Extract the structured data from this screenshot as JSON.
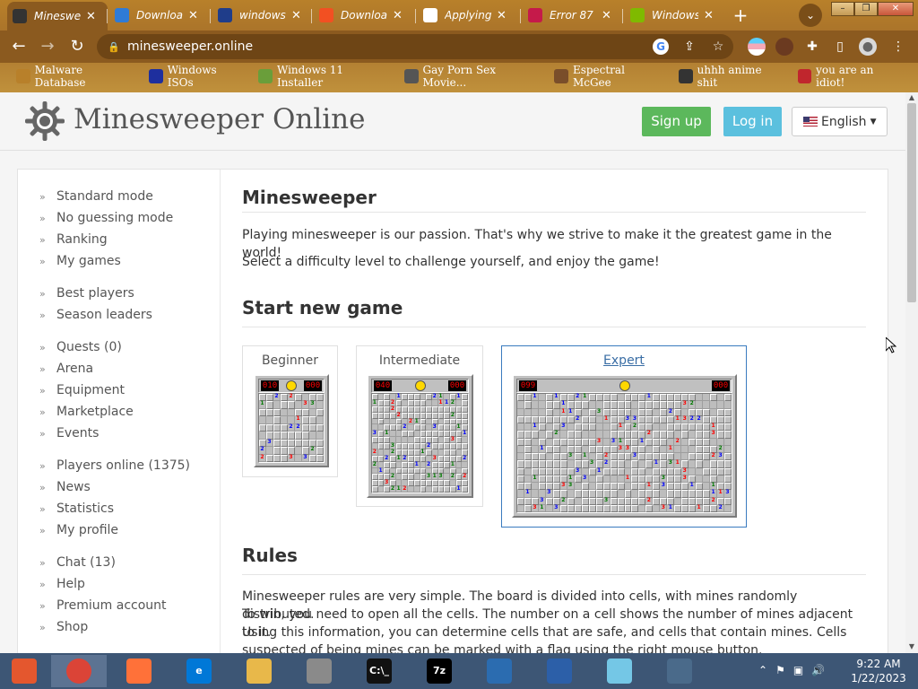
{
  "browser": {
    "tabs": [
      {
        "label": "Minesweeper",
        "favicon_color": "#333333",
        "active": true
      },
      {
        "label": "Download",
        "favicon_color": "#2f7bd6"
      },
      {
        "label": "windows",
        "favicon_color": "#1f3d8a"
      },
      {
        "label": "Download",
        "favicon_color": "#f25022"
      },
      {
        "label": "Applying",
        "favicon_color": "#ffffff"
      },
      {
        "label": "Error 87",
        "favicon_color": "#c51a4a"
      },
      {
        "label": "Windows",
        "favicon_color": "#7fba00"
      }
    ],
    "new_tab": "+",
    "url": "minesweeper.online",
    "window_controls": [
      "–",
      "❐",
      "✕"
    ]
  },
  "bookmarks": [
    {
      "label": "Malware Database",
      "icon": "skull-icon",
      "color": "#b8802a"
    },
    {
      "label": "Windows ISOs",
      "icon": "x-icon",
      "color": "#1e2f9e"
    },
    {
      "label": "Windows 11 Installer",
      "icon": "image-icon",
      "color": "#6a9e3a"
    },
    {
      "label": "Gay Porn Sex Movie...",
      "icon": "box-icon",
      "color": "#555555"
    },
    {
      "label": "Espectral McGee",
      "icon": "avatar-icon",
      "color": "#7a4e2a"
    },
    {
      "label": "uhhh anime shit",
      "icon": "face-icon",
      "color": "#333333"
    },
    {
      "label": "you are an idiot!",
      "icon": "flag-icon",
      "color": "#c0262d"
    }
  ],
  "site": {
    "title": "Minesweeper Online",
    "signup": "Sign up",
    "login": "Log in",
    "language": "English"
  },
  "sidebar": {
    "groups": [
      [
        "Standard mode",
        "No guessing mode",
        "Ranking",
        "My games"
      ],
      [
        "Best players",
        "Season leaders"
      ],
      [
        "Quests (0)",
        "Arena",
        "Equipment",
        "Marketplace",
        "Events"
      ],
      [
        "Players online (1375)",
        "News",
        "Statistics",
        "My profile"
      ],
      [
        "Chat (13)",
        "Help",
        "Premium account",
        "Shop"
      ]
    ]
  },
  "main": {
    "heading": "Minesweeper",
    "intro1": "Playing minesweeper is our passion. That's why we strive to make it the greatest game in the world!",
    "intro2": "Select a difficulty level to challenge yourself, and enjoy the game!",
    "new_game_heading": "Start new game",
    "games": [
      {
        "title": "Beginner",
        "mines": "010",
        "time": "000",
        "cols": 9,
        "rows": 9
      },
      {
        "title": "Intermediate",
        "mines": "040",
        "time": "000",
        "cols": 16,
        "rows": 16
      },
      {
        "title": "Expert",
        "mines": "099",
        "time": "000",
        "cols": 30,
        "rows": 16,
        "selected": true
      }
    ],
    "rules_heading": "Rules",
    "rules_lines": [
      "Minesweeper rules are very simple. The board is divided into cells, with mines randomly distributed.",
      "To win, you need to open all the cells. The number on a cell shows the number of mines adjacent to it.",
      "Using this information, you can determine cells that are safe, and cells that contain mines. Cells",
      "suspected of being mines can be marked with a flag using the right mouse button."
    ]
  },
  "taskbar": {
    "apps": [
      {
        "name": "start",
        "label": "",
        "color": "#e4572e"
      },
      {
        "name": "chrome",
        "label": "",
        "color": "#db4437",
        "active": true
      },
      {
        "name": "firefox",
        "label": "",
        "color": "#ff7139"
      },
      {
        "name": "edge",
        "label": "e",
        "color": "#0078d7"
      },
      {
        "name": "explorer",
        "label": "",
        "color": "#e8b84a"
      },
      {
        "name": "installer",
        "label": "",
        "color": "#8a8a8a"
      },
      {
        "name": "cmd",
        "label": "C:\\_",
        "color": "#111111"
      },
      {
        "name": "7zip",
        "label": "7z",
        "color": "#000000"
      },
      {
        "name": "regedit",
        "label": "",
        "color": "#2b6cb0"
      },
      {
        "name": "virtualbox",
        "label": "",
        "color": "#2c5fa8"
      },
      {
        "name": "notes",
        "label": "",
        "color": "#74c7e6"
      },
      {
        "name": "network",
        "label": "",
        "color": "#4a6a8a"
      }
    ],
    "time": "9:22 AM",
    "date": "1/22/2023"
  }
}
